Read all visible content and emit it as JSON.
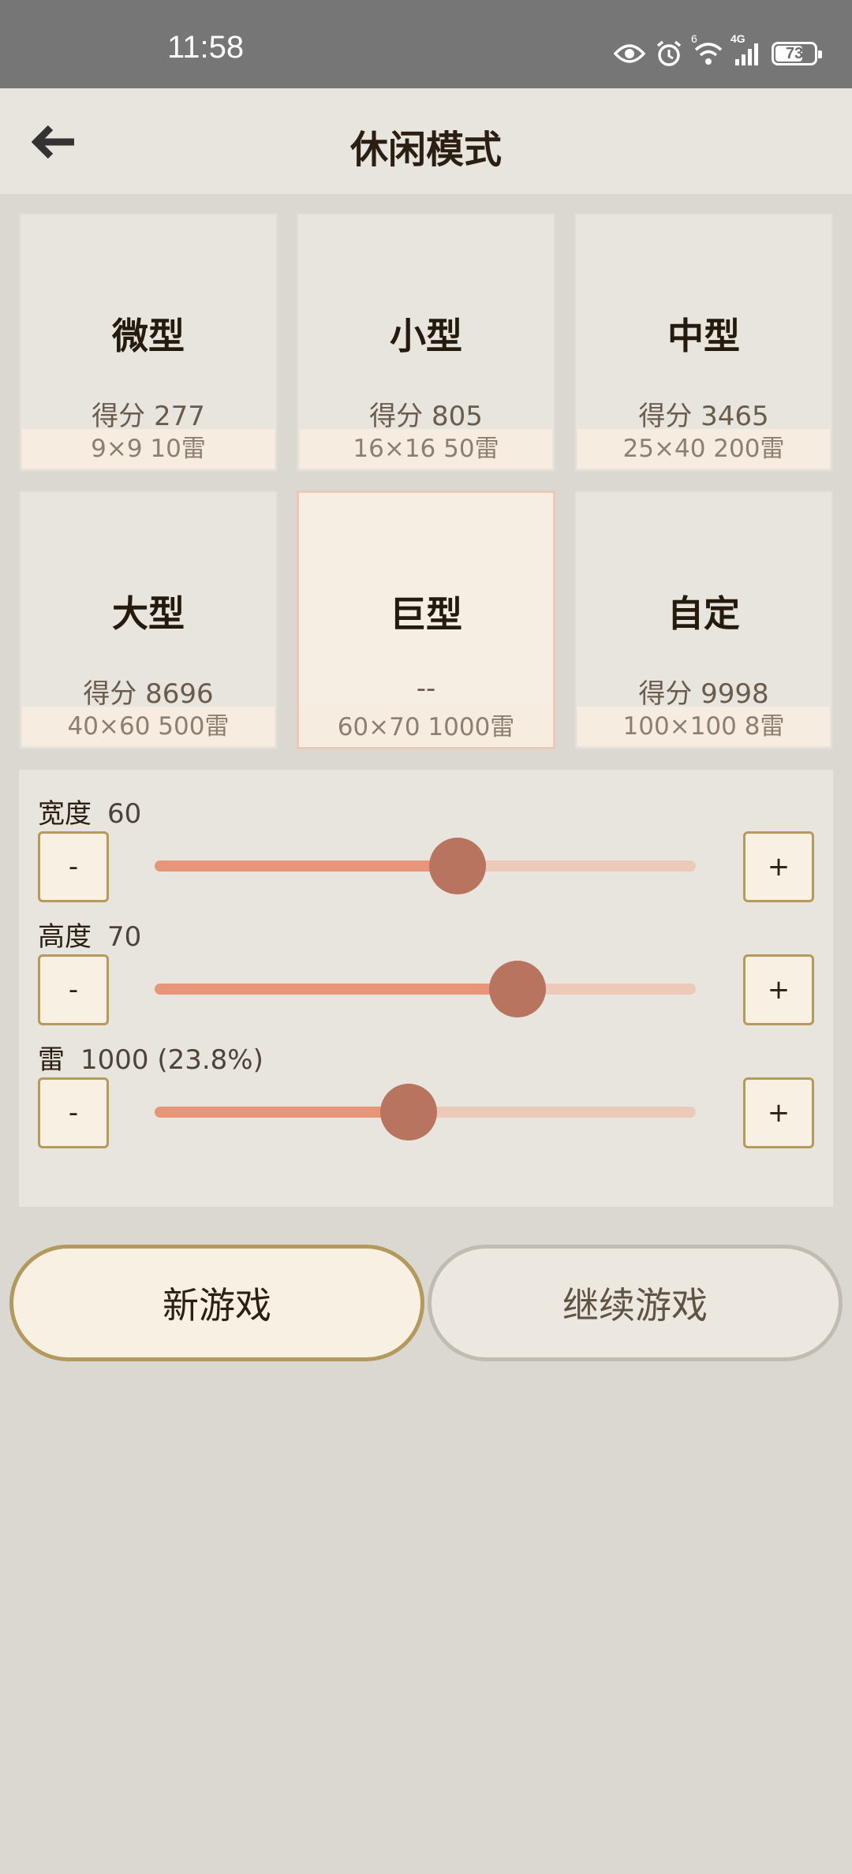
{
  "status": {
    "time": "11:58",
    "battery_level": "73",
    "battery_fraction": 0.73,
    "network_label": "4G",
    "wifi_badge": "6"
  },
  "appbar": {
    "title": "休闲模式"
  },
  "modes": [
    {
      "name": "微型",
      "score": "得分 277",
      "dims": "9×9  10雷"
    },
    {
      "name": "小型",
      "score": "得分 805",
      "dims": "16×16  50雷"
    },
    {
      "name": "中型",
      "score": "得分 3465",
      "dims": "25×40  200雷"
    },
    {
      "name": "大型",
      "score": "得分 8696",
      "dims": "40×60  500雷"
    },
    {
      "name": "巨型",
      "score": "--",
      "dims": "60×70  1000雷"
    },
    {
      "name": "自定",
      "score": "得分 9998",
      "dims": "100×100  8雷"
    }
  ],
  "selected_mode": "巨型",
  "custom": {
    "width": {
      "label": "宽度",
      "value": "60",
      "slider_fraction": 0.56
    },
    "height": {
      "label": "高度",
      "value": "70",
      "slider_fraction": 0.67
    },
    "mines": {
      "label": "雷",
      "value": "1000 (23.8%)",
      "slider_fraction": 0.47
    },
    "minus_label": "-",
    "plus_label": "+"
  },
  "actions": {
    "new_game": "新游戏",
    "continue_game": "继续游戏"
  },
  "colors": {
    "accent": "#e8967a",
    "thumb": "#b8745e",
    "border_gold": "#b3995c",
    "background": "#dbd8d2"
  }
}
